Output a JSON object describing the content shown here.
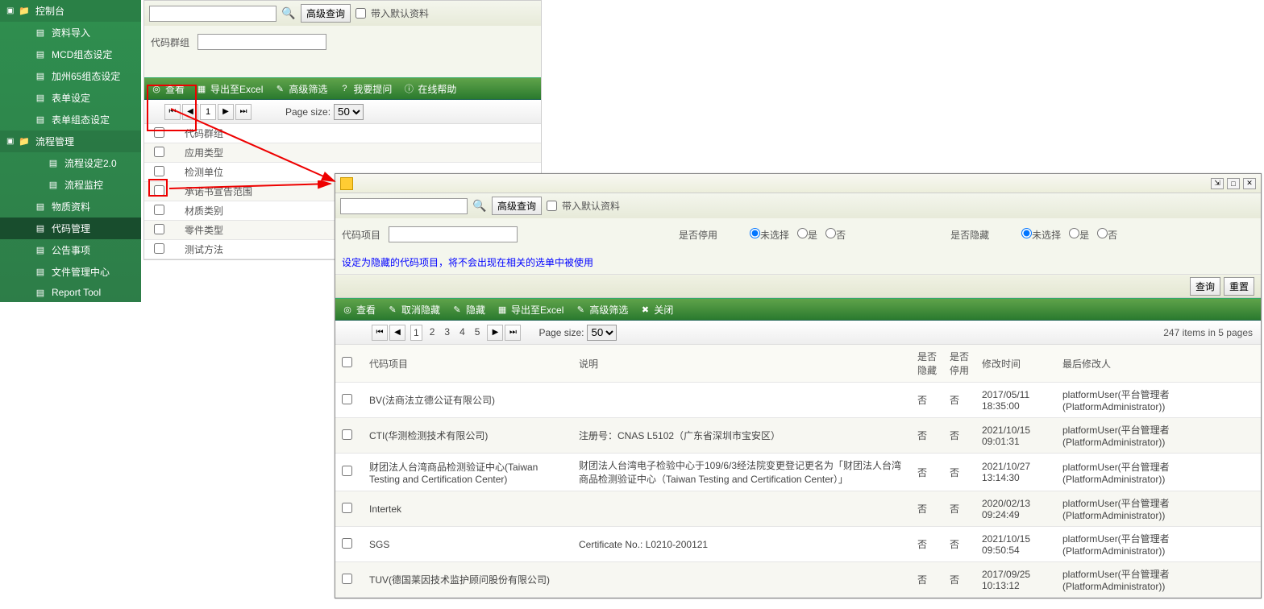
{
  "sidebar": {
    "root1": {
      "label": "控制台",
      "items": [
        {
          "label": "资料导入"
        },
        {
          "label": "MCD组态设定"
        },
        {
          "label": "加州65组态设定"
        },
        {
          "label": "表单设定"
        },
        {
          "label": "表单组态设定"
        }
      ]
    },
    "root2": {
      "label": "流程管理",
      "items": [
        {
          "label": "流程设定2.0"
        },
        {
          "label": "流程监控"
        }
      ]
    },
    "items2": [
      {
        "label": "物质资料"
      },
      {
        "label": "代码管理",
        "active": true
      },
      {
        "label": "公告事项"
      },
      {
        "label": "文件管理中心"
      },
      {
        "label": "Report Tool"
      }
    ]
  },
  "panel1": {
    "search_placeholder": "",
    "adv_search": "高级查询",
    "load_default": "带入默认资料",
    "code_group": "代码群组",
    "toolbar": {
      "view": "查看",
      "export": "导出至Excel",
      "adv_filter": "高级筛选",
      "question": "我要提问",
      "help": "在线帮助"
    },
    "pager": {
      "page": "1",
      "page_size_label": "Page size:",
      "page_size": "50"
    },
    "rows": [
      "代码群组",
      "应用类型",
      "检测单位",
      "承诺书宣告范围",
      "材质类别",
      "零件类型",
      "测试方法"
    ]
  },
  "panel2": {
    "search_placeholder": "",
    "adv_search": "高级查询",
    "load_default": "带入默认资料",
    "field_item": "代码项目",
    "field_disabled": "是否停用",
    "field_hidden": "是否隐藏",
    "radio": {
      "unselected": "未选择",
      "yes": "是",
      "no": "否"
    },
    "note": "设定为隐藏的代码项目，将不会出现在相关的选单中被使用",
    "btn_query": "查询",
    "btn_reset": "重置",
    "toolbar": {
      "view": "查看",
      "unhide": "取消隐藏",
      "hide": "隐藏",
      "export": "导出至Excel",
      "adv_filter": "高级筛选",
      "close": "关闭"
    },
    "pager": {
      "pages": [
        "1",
        "2",
        "3",
        "4",
        "5"
      ],
      "page_size_label": "Page size:",
      "page_size": "50",
      "info": "247 items in 5 pages"
    },
    "columns": {
      "item": "代码项目",
      "desc": "说明",
      "hidden": "是否隐藏",
      "disabled": "是否停用",
      "mtime": "修改时间",
      "muser": "最后修改人"
    },
    "rows": [
      {
        "item": "BV(法商法立德公证有限公司)",
        "desc": "",
        "hidden": "否",
        "disabled": "否",
        "mtime": "2017/05/11 18:35:00",
        "muser": "platformUser(平台管理者(PlatformAdministrator))"
      },
      {
        "item": "CTI(华测检测技术有限公司)",
        "desc": "注册号：CNAS L5102（广东省深圳市宝安区）",
        "hidden": "否",
        "disabled": "否",
        "mtime": "2021/10/15 09:01:31",
        "muser": "platformUser(平台管理者(PlatformAdministrator))"
      },
      {
        "item": "财团法人台湾商品检测验证中心(Taiwan Testing and Certification Center)",
        "desc": "财团法人台湾电子检验中心于109/6/3经法院变更登记更名为「财团法人台湾商品检测验证中心（Taiwan Testing and Certification Center）」",
        "hidden": "否",
        "disabled": "否",
        "mtime": "2021/10/27 13:14:30",
        "muser": "platformUser(平台管理者(PlatformAdministrator))"
      },
      {
        "item": "Intertek",
        "desc": "",
        "hidden": "否",
        "disabled": "否",
        "mtime": "2020/02/13 09:24:49",
        "muser": "platformUser(平台管理者(PlatformAdministrator))"
      },
      {
        "item": "SGS",
        "desc": "Certificate No.: L0210-200121",
        "hidden": "否",
        "disabled": "否",
        "mtime": "2021/10/15 09:50:54",
        "muser": "platformUser(平台管理者(PlatformAdministrator))"
      },
      {
        "item": "TUV(德国莱因技术监护顾问股份有限公司)",
        "desc": "",
        "hidden": "否",
        "disabled": "否",
        "mtime": "2017/09/25 10:13:12",
        "muser": "platformUser(平台管理者(PlatformAdministrator))"
      }
    ]
  }
}
